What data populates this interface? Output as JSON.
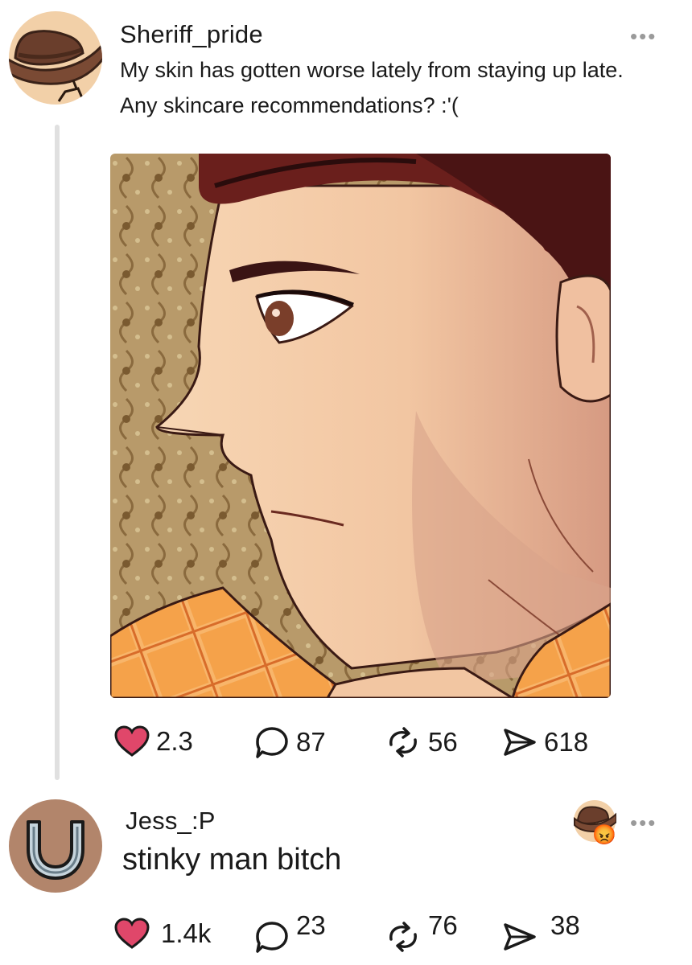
{
  "post": {
    "username": "Sheriff_pride",
    "text_line1": "My skin has gotten worse lately from staying up late.",
    "text_line2": "Any skincare recommendations? :'(",
    "more_label": "•••",
    "stats": {
      "likes": "2.3",
      "comments": "87",
      "reposts": "56",
      "shares": "618"
    }
  },
  "reply": {
    "username": "Jess_:P",
    "text": "stinky man bitch",
    "more_label": "•••",
    "stats": {
      "likes": "1.4k",
      "comments": "23",
      "reposts": "76",
      "shares": "38"
    },
    "reaction_emoji": "😡"
  },
  "icons": {
    "like": "heart-icon",
    "comment": "speech-bubble-icon",
    "repost": "repost-arrows-icon",
    "share": "send-icon",
    "avatar_post": "cowboy-hat-avatar",
    "avatar_reply": "horseshoe-avatar"
  },
  "colors": {
    "like": "#e0476a",
    "avatar_post_bg": "#f2d0a8",
    "avatar_reply_bg": "#b2856b"
  }
}
